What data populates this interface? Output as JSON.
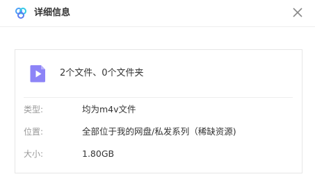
{
  "dialog": {
    "title": "详细信息",
    "logo_icon": "baidu-netdisk-logo-icon",
    "close_icon": "close-icon"
  },
  "summary": {
    "file_icon": "video-file-icon",
    "text": "2个文件、0个文件夹"
  },
  "details": {
    "type_label": "类型:",
    "type_value": "均为m4v文件",
    "location_label": "位置:",
    "location_value": "全部位于我的网盘/私发系列（稀缺资源)",
    "size_label": "大小:",
    "size_value": "1.80GB"
  },
  "colors": {
    "icon_purple": "#8a7cf5",
    "logo_blue": "#3aa3f5",
    "text_primary": "#333333",
    "text_secondary": "#999999"
  }
}
